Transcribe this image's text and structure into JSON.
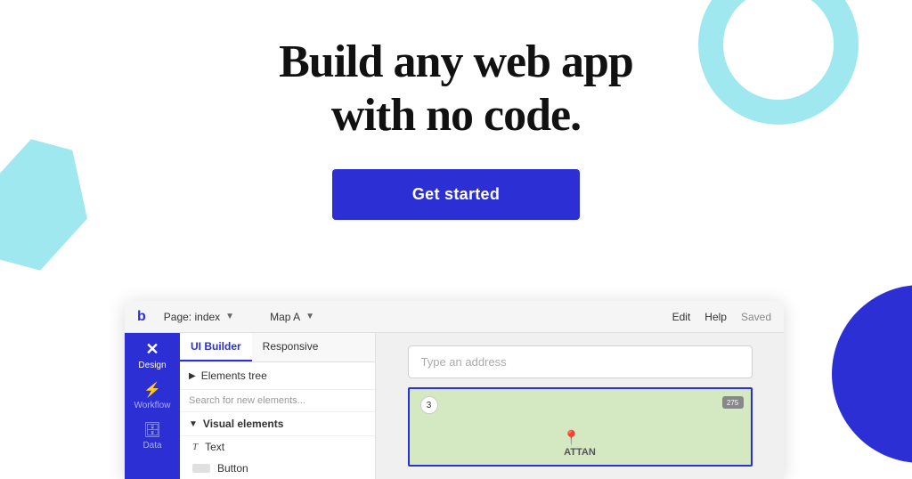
{
  "hero": {
    "title_line1": "Build any web app",
    "title_line2": "with no code.",
    "cta_label": "Get started"
  },
  "mockup": {
    "topbar": {
      "logo": "b",
      "page_selector": "Page: index",
      "map_selector": "Map A",
      "menu_edit": "Edit",
      "menu_help": "Help",
      "status": "Saved"
    },
    "sidebar": {
      "design_label": "Design",
      "workflow_label": "Workflow",
      "data_label": "Data"
    },
    "panel": {
      "tab1": "UI Builder",
      "tab2": "Responsive",
      "elements_tree": "Elements tree",
      "search_placeholder": "Search for new elements...",
      "section_visual": "Visual elements",
      "item_text": "Text",
      "item_button": "Button"
    },
    "canvas": {
      "input_placeholder": "Type an address",
      "map_label": "ATTAN"
    }
  }
}
